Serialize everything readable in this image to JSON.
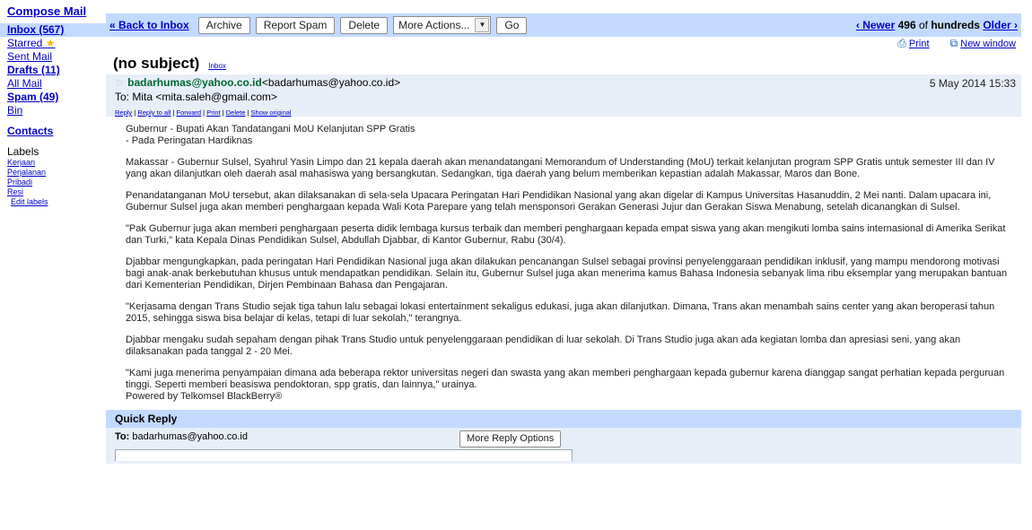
{
  "sidebar": {
    "compose": "Compose Mail",
    "items": [
      {
        "label": "Inbox (567)",
        "style": "active"
      },
      {
        "label": "Starred",
        "icon": "star-icon"
      },
      {
        "label": "Sent Mail"
      },
      {
        "label": "Drafts (11)",
        "style": "bold"
      },
      {
        "label": "All Mail"
      },
      {
        "label": "Spam (49)",
        "style": "bold"
      },
      {
        "label": "Bin"
      }
    ],
    "contacts": "Contacts",
    "labels_title": "Labels",
    "labels": [
      "Kerjaan",
      "Perjalanan",
      "Pribadi",
      "Resi"
    ],
    "edit_labels": "Edit labels"
  },
  "toolbar": {
    "back": "« Back to Inbox",
    "archive": "Archive",
    "report_spam": "Report Spam",
    "delete": "Delete",
    "more_actions": "More Actions...",
    "go": "Go",
    "newer": "‹ Newer",
    "pager_count": "496",
    "pager_of": " of ",
    "pager_total": "hundreds",
    "older": "Older ›"
  },
  "print_bar": {
    "print": "Print",
    "new_window": "New window"
  },
  "message": {
    "subject": "(no subject)",
    "tag": "Inbox",
    "sender_name": "badarhumas@yahoo.co.id",
    "sender_email": "<badarhumas@yahoo.co.id>",
    "to": "To: Mita <mita.saleh@gmail.com>",
    "date": "5 May 2014 15:33",
    "actions": [
      "Reply",
      "Reply to all",
      "Forward",
      "Print",
      "Delete",
      "Show original"
    ],
    "body": [
      "Gubernur - Bupati Akan Tandatangani MoU Kelanjutan SPP Gratis\n- Pada Peringatan Hardiknas",
      "Makassar - Gubernur Sulsel, Syahrul Yasin Limpo dan 21 kepala daerah akan menandatangani Memorandum of Understanding (MoU) terkait kelanjutan program SPP Gratis untuk semester III dan IV yang akan dilanjutkan oleh daerah asal mahasiswa yang bersangkutan. Sedangkan, tiga daerah yang belum memberikan kepastian adalah Makassar, Maros dan Bone.",
      "Penandatanganan MoU tersebut, akan dilaksanakan di sela-sela Upacara Peringatan Hari Pendidikan Nasional yang akan digelar di Kampus Universitas Hasanuddin, 2 Mei nanti. Dalam upacara ini, Gubernur Sulsel juga akan memberi penghargaan kepada Wali Kota Parepare yang telah mensponsori Gerakan Generasi Jujur dan Gerakan Siswa Menabung, setelah dicanangkan di Sulsel.",
      "\"Pak Gubernur juga akan memberi penghargaan peserta didik lembaga kursus terbaik dan memberi penghargaan kepada empat siswa yang akan mengikuti lomba sains internasional di Amerika Serikat dan Turki,\" kata Kepala Dinas Pendidikan Sulsel, Abdullah Djabbar, di Kantor Gubernur, Rabu (30/4).",
      "Djabbar mengungkapkan, pada peringatan Hari Pendidikan Nasional juga akan dilakukan pencanangan Sulsel sebagai provinsi penyelenggaraan pendidikan inklusif, yang mampu mendorong motivasi bagi anak-anak berkebutuhan khusus untuk mendapatkan pendidikan. Selain itu, Gubernur Sulsel juga akan menerima kamus Bahasa Indonesia sebanyak lima ribu eksemplar yang merupakan bantuan dari Kementerian Pendidikan, Dirjen Pembinaan Bahasa dan Pengajaran.",
      "\"Kerjasama dengan Trans Studio sejak tiga tahun lalu sebagai lokasi entertainment sekaligus edukasi, juga akan dilanjutkan. Dimana, Trans akan menambah sains center yang akan beroperasi tahun 2015, sehingga siswa bisa belajar di kelas, tetapi di luar sekolah,\" terangnya.",
      "Djabbar mengaku sudah sepaham dengan pihak Trans Studio untuk penyelenggaraan pendidikan di luar sekolah. Di Trans Studio juga akan ada kegiatan lomba dan apresiasi seni, yang akan dilaksanakan pada tanggal 2 - 20 Mei.",
      "\"Kami juga menerima penyampaian dimana ada beberapa rektor universitas negeri dan swasta yang akan memberi penghargaan kepada gubernur karena dianggap sangat perhatian kepada perguruan tinggi. Seperti memberi beasiswa pendoktoran, spp gratis, dan lainnya,\" urainya.\nPowered by Telkomsel BlackBerry®"
    ]
  },
  "quick_reply": {
    "title": "Quick Reply",
    "to_label": "To:",
    "to_value": " badarhumas@yahoo.co.id",
    "more_options": "More Reply Options"
  }
}
